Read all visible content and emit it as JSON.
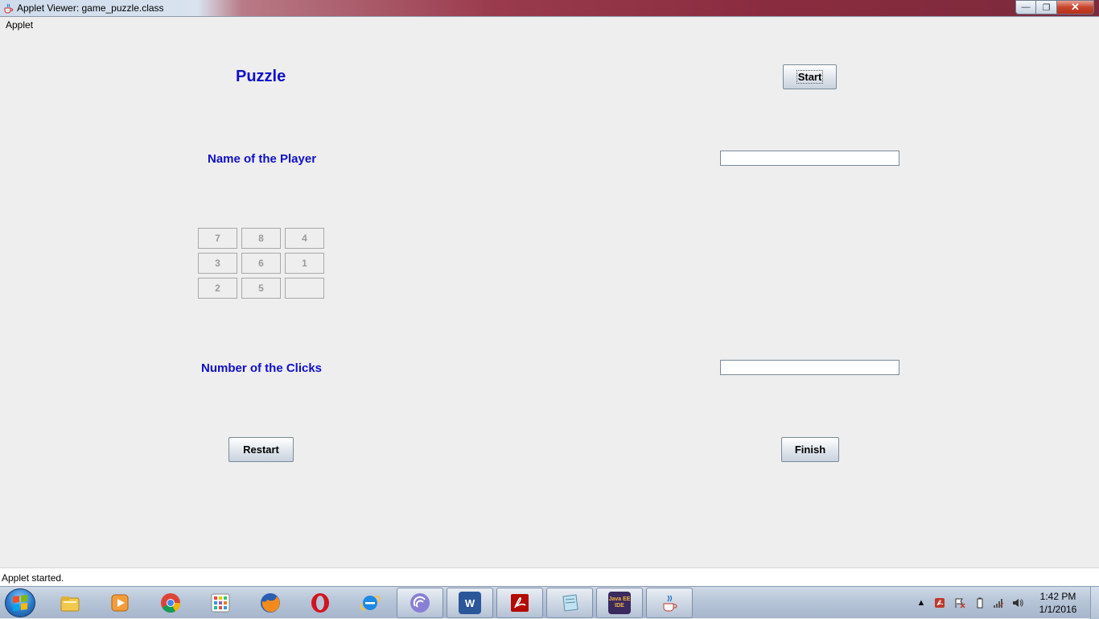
{
  "window": {
    "title": "Applet Viewer: game_puzzle.class",
    "minimize_glyph": "—",
    "maximize_glyph": "❐",
    "close_glyph": "✕"
  },
  "menubar": {
    "applet_menu": "Applet"
  },
  "applet": {
    "title": "Puzzle",
    "start_label": "Start",
    "player_name_label": "Name of the Player",
    "player_name_value": "",
    "clicks_label": "Number of the Clicks",
    "clicks_value": "",
    "restart_label": "Restart",
    "finish_label": "Finish",
    "tiles": [
      "7",
      "8",
      "4",
      "3",
      "6",
      "1",
      "2",
      "5",
      ""
    ]
  },
  "status": {
    "text": "Applet started."
  },
  "taskbar": {
    "pinned": [
      {
        "name": "windows-explorer",
        "icon": "folder-icon"
      },
      {
        "name": "media-player",
        "icon": "media-player-icon"
      },
      {
        "name": "chrome",
        "icon": "chrome-icon"
      },
      {
        "name": "apps-grid",
        "icon": "apps-grid-icon"
      },
      {
        "name": "firefox",
        "icon": "firefox-icon"
      },
      {
        "name": "opera",
        "icon": "opera-icon"
      },
      {
        "name": "internet-explorer",
        "icon": "internet-explorer-icon"
      },
      {
        "name": "bittorrent",
        "icon": "bittorrent-icon"
      },
      {
        "name": "word",
        "icon": "word-icon",
        "text": "W"
      },
      {
        "name": "acrobat",
        "icon": "acrobat-icon"
      },
      {
        "name": "notepad",
        "icon": "notepad-icon"
      },
      {
        "name": "java-ee-ide",
        "icon": "java-ee-ide-icon",
        "text": "Java EE IDE"
      },
      {
        "name": "java",
        "icon": "java-icon"
      }
    ],
    "clock_time": "1:42 PM",
    "clock_date": "1/1/2016"
  },
  "colors": {
    "label_blue": "#1010c8",
    "tile_text": "#9a9a9a",
    "background": "#eeeeee"
  }
}
